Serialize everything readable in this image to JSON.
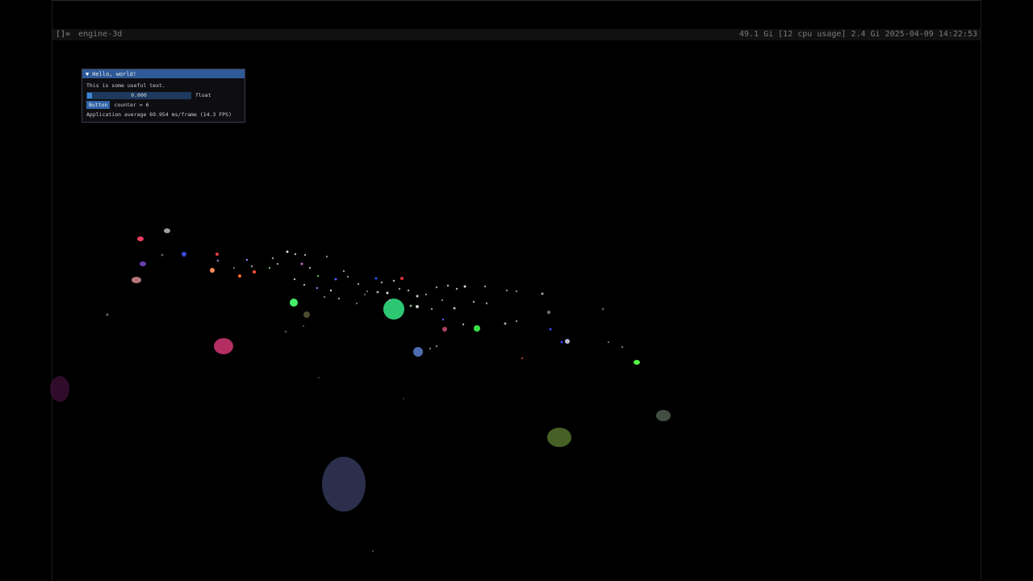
{
  "topbar": {
    "layout_symbol": "[]=",
    "window_title": "engine-3d",
    "status": "49.1 Gi [12 cpu usage] 2.4 Gi 2025-04-09 14:22:53"
  },
  "imgui_window": {
    "title": "Hello, world!",
    "text": "This is some useful text.",
    "slider_value": "0.000",
    "slider_fraction": 0,
    "slider_label": "float",
    "button_label": "Button",
    "counter_text": "counter = 6",
    "perf_text": "Application average 69.954 ms/frame (14.3 FPS)"
  },
  "colors": {
    "background": "#000000",
    "imgui_title_bg": "#2f5a98",
    "imgui_button": "#2f64a8"
  },
  "icons": {
    "collapse": "triangle-down-icon"
  }
}
